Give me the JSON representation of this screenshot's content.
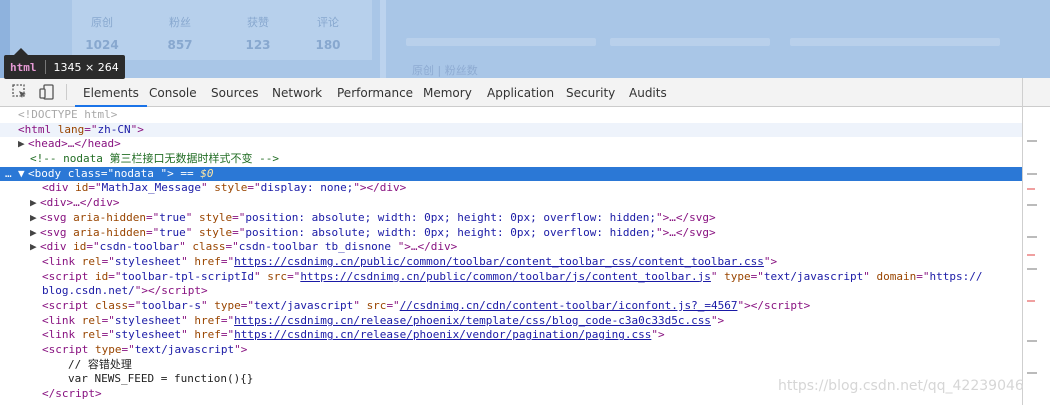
{
  "preview": {
    "stats": [
      {
        "label": "原创",
        "value": "1024"
      },
      {
        "label": "粉丝",
        "value": "857"
      },
      {
        "label": "获赞",
        "value": "123"
      },
      {
        "label": "评论",
        "value": "180"
      }
    ],
    "faint_text": "原创 | 粉丝数"
  },
  "tooltip": {
    "tag": "html",
    "size": "1345 × 264"
  },
  "devtools": {
    "tabs": [
      "Elements",
      "Console",
      "Sources",
      "Network",
      "Performance",
      "Memory",
      "Application",
      "Security",
      "Audits"
    ],
    "active_tab": "Elements"
  },
  "dom": {
    "doctype": "<!DOCTYPE html>",
    "html_lang": "zh-CN",
    "comment": "<!-- nodata 第三栏接口无数据时样式不变 -->",
    "body_class": "nodata ",
    "dollar_zero": "$0",
    "mathjax_id": "MathJax_Message",
    "mathjax_style": "display: none;",
    "svg_aria": "true",
    "svg_style": "position: absolute; width: 0px; height: 0px; overflow: hidden;",
    "toolbar_id": "csdn-toolbar",
    "toolbar_class": "csdn-toolbar tb_disnone ",
    "link1_rel": "stylesheet",
    "link1_href": "https://csdnimg.cn/public/common/toolbar/content_toolbar_css/content_toolbar.css",
    "script1_id": "toolbar-tpl-scriptId",
    "script1_src": "https://csdnimg.cn/public/common/toolbar/js/content_toolbar.js",
    "script1_type": "text/javascript",
    "script1_domain_a": "https://",
    "script1_domain_b": "blog.csdn.net/",
    "script2_class": "toolbar-s",
    "script2_type": "text/javascript",
    "script2_src": "//csdnimg.cn/cdn/content-toolbar/iconfont.js?_=4567",
    "link2_href": "https://csdnimg.cn/release/phoenix/template/css/blog_code-c3a0c33d5c.css",
    "link3_href": "https://csdnimg.cn/release/phoenix/vendor/pagination/paging.css",
    "script3_type": "text/javascript",
    "js_comment": "// 容错处理",
    "js_code": "var NEWS_FEED = function(){}"
  },
  "watermark": "https://blog.csdn.net/qq_42239046"
}
